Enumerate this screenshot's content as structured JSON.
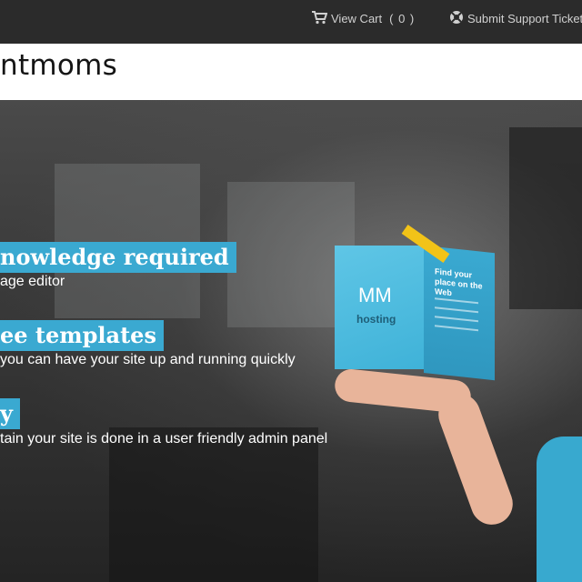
{
  "topbar": {
    "cart_label": "View Cart",
    "cart_count": "( 0 )",
    "ticket_label": "Submit Support Ticket"
  },
  "logo": {
    "text": "ntmoms"
  },
  "hero": {
    "features": [
      {
        "title": "nowledge required",
        "subtitle": "age editor"
      },
      {
        "title": "ee templates",
        "subtitle": "you can have your site up and running quickly"
      },
      {
        "title": "y",
        "subtitle": "tain your site is done in a user friendly admin panel"
      }
    ],
    "box": {
      "front_logo": "MM",
      "front_sub": "hosting",
      "side_title": "Find your place on the Web"
    }
  },
  "colors": {
    "accent": "#3aa9d1",
    "topbar": "#2b2b2b",
    "ribbon": "#f2c318"
  },
  "icons": {
    "cart": "cart-icon",
    "ticket": "support-icon"
  }
}
